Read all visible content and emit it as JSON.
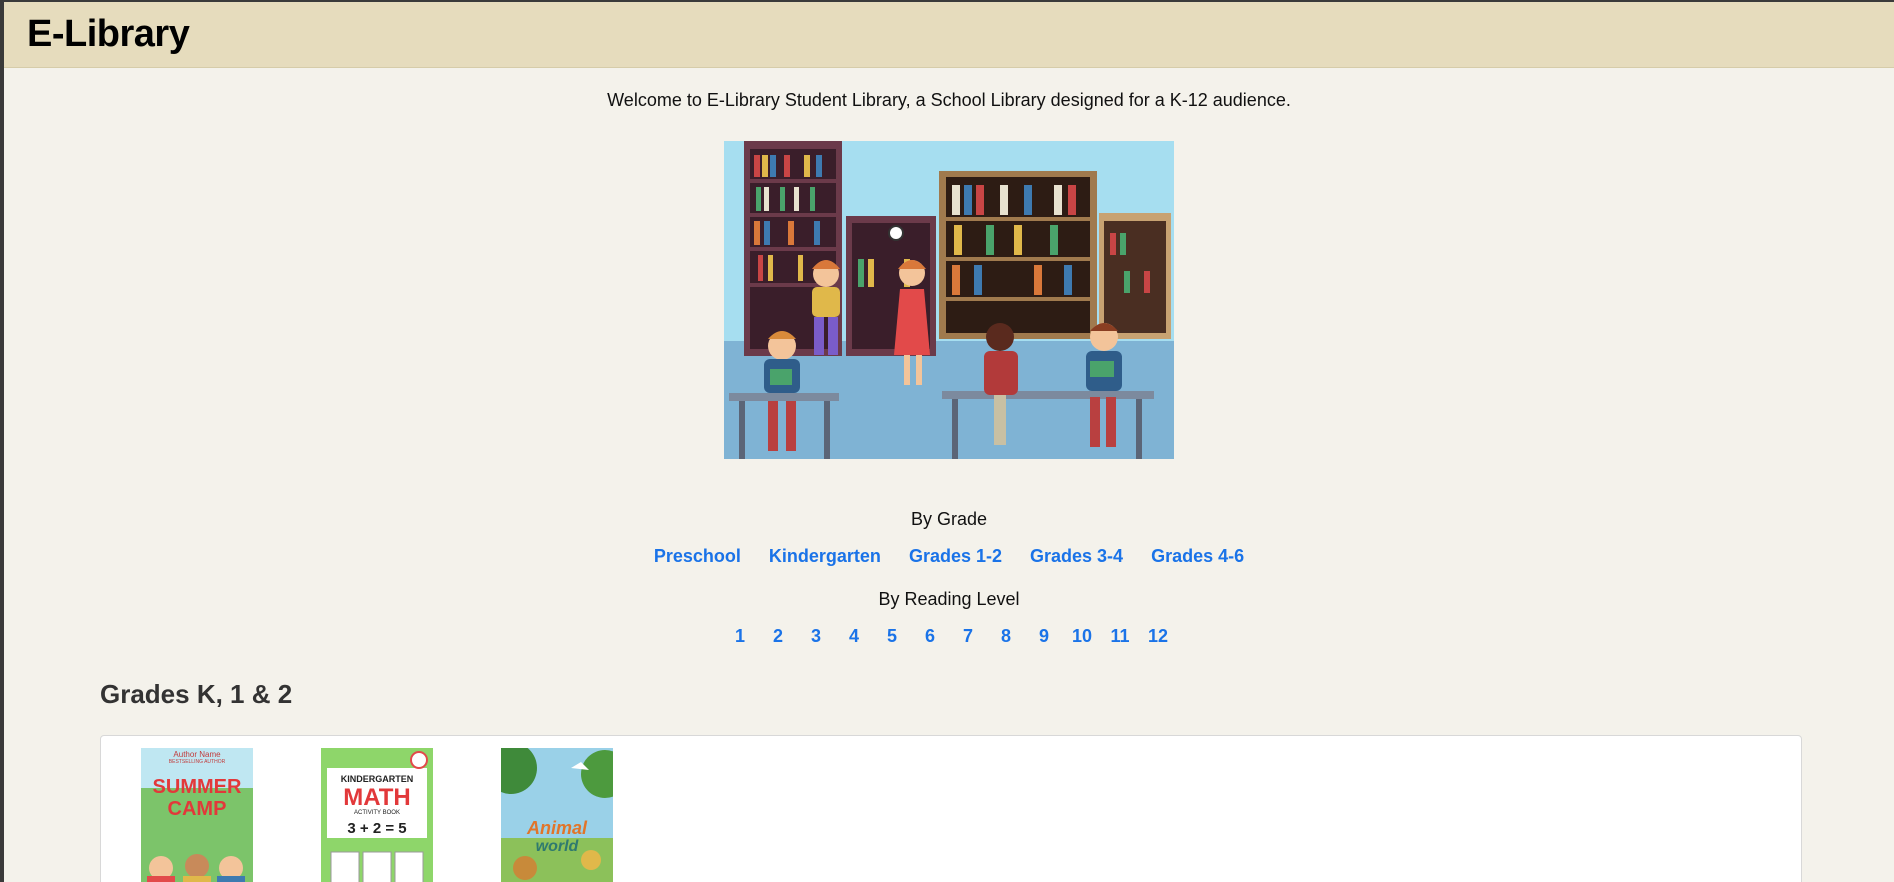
{
  "header": {
    "brand": "E-Library"
  },
  "welcome_text": "Welcome to E-Library Student Library, a School Library designed for a K-12 audience.",
  "by_grade": {
    "label": "By Grade",
    "links": [
      "Preschool",
      "Kindergarten",
      "Grades 1-2",
      "Grades 3-4",
      "Grades 4-6"
    ]
  },
  "by_reading_level": {
    "label": "By Reading Level",
    "levels": [
      "1",
      "2",
      "3",
      "4",
      "5",
      "6",
      "7",
      "8",
      "9",
      "10",
      "11",
      "12"
    ]
  },
  "shelf": {
    "title": "Grades K, 1 & 2",
    "books": [
      {
        "cover_top": "Author Name",
        "cover_sub": "BESTSELLING AUTHOR",
        "cover_title_a": "SUMMER",
        "cover_title_b": "CAMP"
      },
      {
        "cover_top": "KINDERGARTEN",
        "cover_title_a": "MATH",
        "cover_sub": "ACTIVITY BOOK",
        "equation": "3 + 2 = 5"
      },
      {
        "cover_title_a": "Animal",
        "cover_title_b": "world"
      }
    ]
  },
  "colors": {
    "header_bg": "#e6dcbd",
    "page_bg": "#f4f2eb",
    "link": "#1a73e8"
  }
}
